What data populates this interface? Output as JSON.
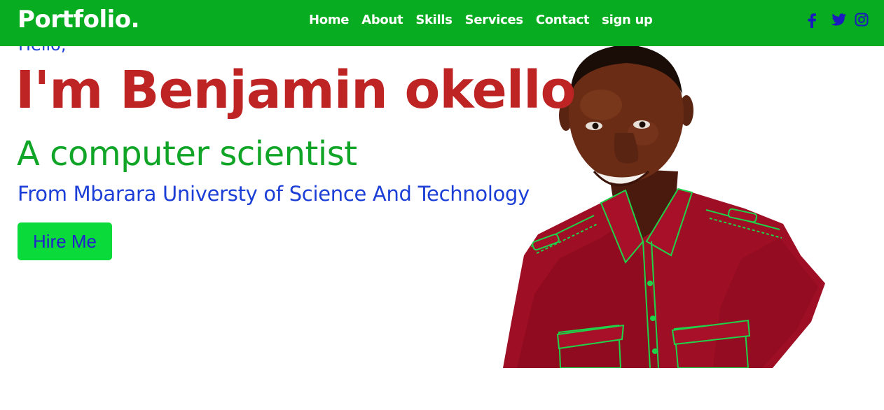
{
  "colors": {
    "nav_background": "#08AC20",
    "nav_text": "#FFFFFF",
    "social_icon": "#1A1ABF",
    "hello_text": "#1B3FD6",
    "name_text": "#BE2424",
    "role_text": "#10A526",
    "school_text": "#1B3FD6",
    "button_background": "#0BDB3A",
    "button_text": "#2222CC",
    "page_background": "#FFFFFF"
  },
  "header": {
    "logo": "Portfolio.",
    "nav": [
      {
        "label": "Home"
      },
      {
        "label": "About"
      },
      {
        "label": "Skills"
      },
      {
        "label": "Services"
      },
      {
        "label": "Contact"
      },
      {
        "label": "sign up"
      }
    ],
    "social_icons": [
      "facebook-icon",
      "twitter-icon",
      "instagram-icon"
    ]
  },
  "hero": {
    "greeting": "Hello,",
    "name": "I'm Benjamin okello",
    "role": "A computer scientist",
    "school": "From Mbarara Universty of Science And Technology",
    "cta_label": "Hire Me",
    "photo": "portrait-photo"
  }
}
